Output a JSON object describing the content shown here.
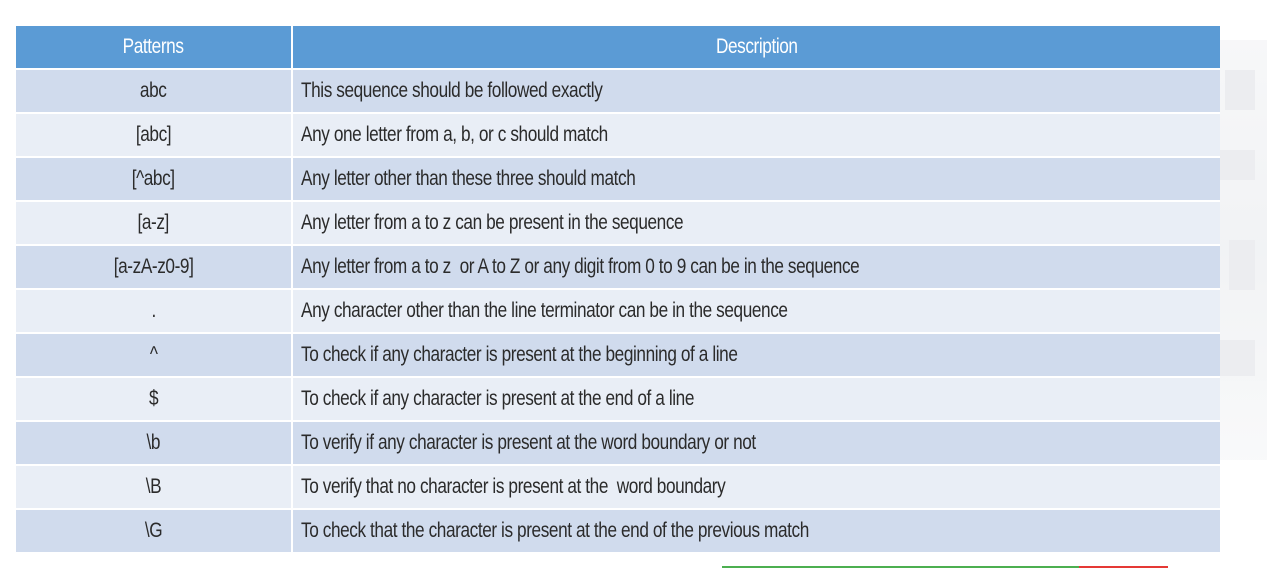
{
  "table": {
    "headers": {
      "pattern": "Patterns",
      "description": "Description"
    },
    "rows": [
      {
        "pattern": "abc",
        "description": "This sequence should be followed exactly"
      },
      {
        "pattern": "[abc]",
        "description": "Any one letter from a, b, or c should match"
      },
      {
        "pattern": "[^abc]",
        "description": "Any letter other than these three should match"
      },
      {
        "pattern": "[a-z]",
        "description": "Any letter from a to z can be present in the sequence"
      },
      {
        "pattern": "[a-zA-z0-9]",
        "description": "Any letter from a to z  or A to Z or any digit from 0 to 9 can be in the sequence"
      },
      {
        "pattern": ".",
        "description": "Any character other than the line terminator can be in the sequence"
      },
      {
        "pattern": "^",
        "description": "To check if any character is present at the beginning of a line"
      },
      {
        "pattern": "$",
        "description": "To check if any character is present at the end of a line"
      },
      {
        "pattern": "\\b",
        "description": "To verify if any character is present at the word boundary or not"
      },
      {
        "pattern": "\\B",
        "description": "To verify that no character is present at the  word boundary"
      },
      {
        "pattern": "\\G",
        "description": "To check that the character is present at the end of the previous match"
      }
    ]
  },
  "colors": {
    "header_bg": "#5b9bd5",
    "row_odd_bg": "#d0dbed",
    "row_even_bg": "#e9eef6",
    "text": "#2b2b2b"
  }
}
